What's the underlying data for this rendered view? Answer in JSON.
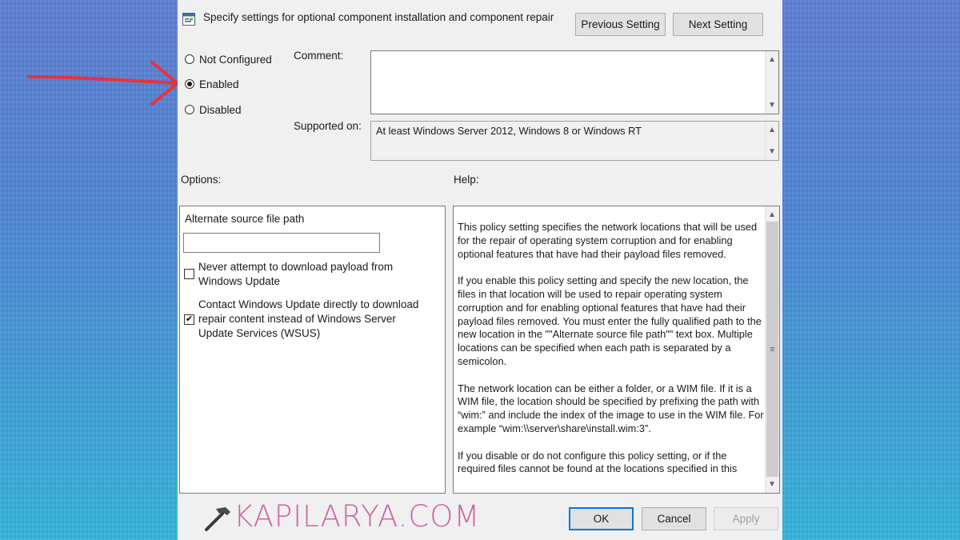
{
  "header": {
    "title": "Specify settings for optional component installation and component repair",
    "prev_label": "Previous Setting",
    "next_label": "Next Setting"
  },
  "state": {
    "options": [
      {
        "label": "Not Configured",
        "checked": false
      },
      {
        "label": "Enabled",
        "checked": true
      },
      {
        "label": "Disabled",
        "checked": false
      }
    ]
  },
  "comment": {
    "label": "Comment:",
    "value": ""
  },
  "supported": {
    "label": "Supported on:",
    "value": "At least Windows Server 2012, Windows 8 or Windows RT"
  },
  "options_panel": {
    "heading": "Options:",
    "alt_source_label": "Alternate source file path",
    "alt_source_value": "",
    "never_download": {
      "label": "Never attempt to download payload from Windows Update",
      "checked": false
    },
    "contact_wu": {
      "label": "Contact Windows Update directly to download repair content instead of Windows Server Update Services (WSUS)",
      "checked": true
    }
  },
  "help_panel": {
    "heading": "Help:",
    "paragraphs": [
      "This policy setting specifies the network locations that will be used for the repair of operating system corruption and for enabling optional features that have had their payload files removed.",
      "If you enable this policy setting and specify the new location, the files in that location will be used to repair operating system corruption and for enabling optional features that have had their payload files removed. You must enter the fully qualified path to the new location in the \"\"Alternate source file path\"\" text box. Multiple locations can be specified when each path is separated by a semicolon.",
      "The network location can be either a folder, or a WIM file. If it is a WIM file, the location should be specified by prefixing the path with “wim:” and include the index of the image to use in the WIM file. For example “wim:\\\\server\\share\\install.wim:3”.",
      "If you disable or do not configure this policy setting, or if the required files cannot be found at the locations specified in this"
    ]
  },
  "footer": {
    "ok_label": "OK",
    "cancel_label": "Cancel",
    "apply_label": "Apply"
  },
  "watermark": {
    "text": "KAPILARYA.COM"
  },
  "colors": {
    "arrow": "#e8323c",
    "focus": "#0078d7",
    "watermark": "#c9569c"
  }
}
